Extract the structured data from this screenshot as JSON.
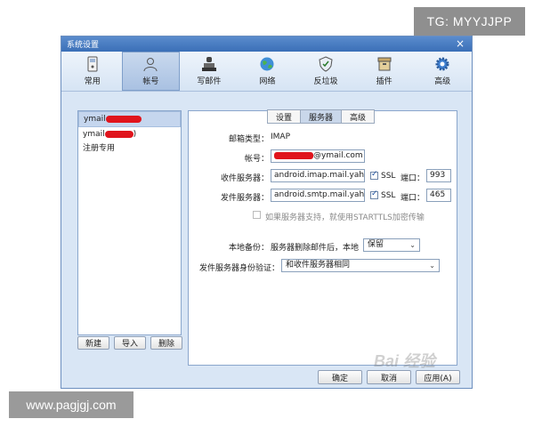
{
  "window": {
    "title": "系统设置",
    "close": "×"
  },
  "toolbar": [
    {
      "label": "常用",
      "icon": "phone-icon",
      "active": false
    },
    {
      "label": "帐号",
      "icon": "user-icon",
      "active": true
    },
    {
      "label": "写邮件",
      "icon": "stamp-icon",
      "active": false
    },
    {
      "label": "网络",
      "icon": "globe-icon",
      "active": false
    },
    {
      "label": "反垃圾",
      "icon": "shield-icon",
      "active": false
    },
    {
      "label": "插件",
      "icon": "box-icon",
      "active": false
    },
    {
      "label": "高级",
      "icon": "gear-icon",
      "active": false
    }
  ],
  "accounts": [
    {
      "prefix": "ymail",
      "suffix": "",
      "selected": true
    },
    {
      "prefix": "ymail",
      "suffix": ")",
      "selected": false
    },
    {
      "prefix": "注册专用",
      "suffix": "",
      "selected": false
    }
  ],
  "left_buttons": {
    "new": "新建",
    "import": "导入",
    "delete": "删除"
  },
  "tabs": [
    "设置",
    "服务器",
    "高级"
  ],
  "active_tab": "服务器",
  "form": {
    "mailbox_type_label": "邮箱类型：",
    "mailbox_type_value": "IMAP",
    "account_label": "帐号：",
    "account_suffix": "@ymail.com",
    "incoming_label": "收件服务器：",
    "incoming_value": "android.imap.mail.yahoo",
    "incoming_ssl": "SSL",
    "incoming_port_label": "端口：",
    "incoming_port": "993",
    "outgoing_label": "发件服务器：",
    "outgoing_value": "android.smtp.mail.yaho",
    "outgoing_ssl": "SSL",
    "outgoing_port_label": "端口：",
    "outgoing_port": "465",
    "starttls_label": "如果服务器支持，就使用STARTTLS加密传输",
    "backup_label": "本地备份：",
    "backup_text": "服务器删除邮件后，本地",
    "backup_value": "保留",
    "auth_label": "发件服务器身份验证：",
    "auth_value": "和收件服务器相同"
  },
  "bottom_buttons": {
    "ok": "确定",
    "cancel": "取消",
    "apply": "应用(A)"
  },
  "watermarks": {
    "top_right": "TG: MYYJJPP",
    "bottom_left": "www.pagjgj.com",
    "baidu": "Bai 经验"
  }
}
